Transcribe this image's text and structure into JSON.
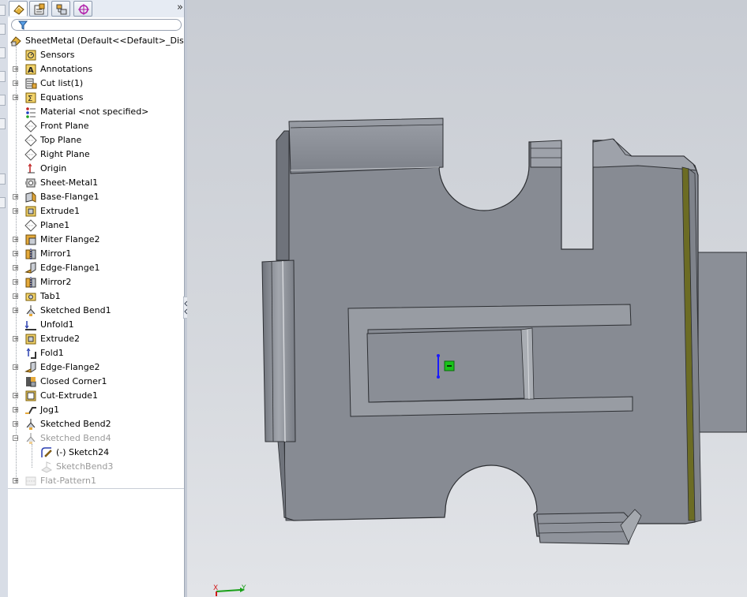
{
  "feature_tree": {
    "root": "SheetMetal  (Default<<Default>_Display",
    "items": [
      {
        "label": "Sensors",
        "expandable": false,
        "icon": "sensors-icon"
      },
      {
        "label": "Annotations",
        "expandable": true,
        "icon": "annotations-icon"
      },
      {
        "label": "Cut list(1)",
        "expandable": true,
        "icon": "cut-list-icon"
      },
      {
        "label": "Equations",
        "expandable": true,
        "icon": "equations-icon"
      },
      {
        "label": "Material <not specified>",
        "expandable": false,
        "icon": "material-icon"
      },
      {
        "label": "Front Plane",
        "expandable": false,
        "icon": "plane-icon"
      },
      {
        "label": "Top Plane",
        "expandable": false,
        "icon": "plane-icon"
      },
      {
        "label": "Right Plane",
        "expandable": false,
        "icon": "plane-icon"
      },
      {
        "label": "Origin",
        "expandable": false,
        "icon": "origin-icon"
      },
      {
        "label": "Sheet-Metal1",
        "expandable": false,
        "icon": "sheet-metal-icon"
      },
      {
        "label": "Base-Flange1",
        "expandable": true,
        "icon": "base-flange-icon"
      },
      {
        "label": "Extrude1",
        "expandable": true,
        "icon": "extrude-icon"
      },
      {
        "label": "Plane1",
        "expandable": false,
        "icon": "plane-icon"
      },
      {
        "label": "Miter Flange2",
        "expandable": true,
        "icon": "miter-flange-icon"
      },
      {
        "label": "Mirror1",
        "expandable": true,
        "icon": "mirror-icon"
      },
      {
        "label": "Edge-Flange1",
        "expandable": true,
        "icon": "edge-flange-icon"
      },
      {
        "label": "Mirror2",
        "expandable": true,
        "icon": "mirror-icon"
      },
      {
        "label": "Tab1",
        "expandable": true,
        "icon": "tab-icon"
      },
      {
        "label": "Sketched Bend1",
        "expandable": true,
        "icon": "sketched-bend-icon"
      },
      {
        "label": "Unfold1",
        "expandable": false,
        "icon": "unfold-icon"
      },
      {
        "label": "Extrude2",
        "expandable": true,
        "icon": "extrude-icon"
      },
      {
        "label": "Fold1",
        "expandable": false,
        "icon": "fold-icon"
      },
      {
        "label": "Edge-Flange2",
        "expandable": true,
        "icon": "edge-flange-icon"
      },
      {
        "label": "Closed Corner1",
        "expandable": false,
        "icon": "closed-corner-icon"
      },
      {
        "label": "Cut-Extrude1",
        "expandable": true,
        "icon": "cut-extrude-icon"
      },
      {
        "label": "Jog1",
        "expandable": true,
        "icon": "jog-icon"
      },
      {
        "label": "Sketched Bend2",
        "expandable": true,
        "icon": "sketched-bend-icon"
      },
      {
        "label": "Sketched Bend4",
        "expandable": true,
        "expanded": true,
        "dim": true,
        "icon": "sketched-bend-icon"
      },
      {
        "label": "(-) Sketch24",
        "expandable": false,
        "child": true,
        "icon": "sketch-icon"
      },
      {
        "label": "SketchBend3",
        "expandable": false,
        "child": true,
        "dim": true,
        "icon": "sketch-bend-icon"
      },
      {
        "label": "Flat-Pattern1",
        "expandable": true,
        "dim": true,
        "icon": "flat-pattern-icon"
      }
    ]
  },
  "panel_tabs": [
    "feature-manager-tab",
    "property-manager-tab",
    "configuration-manager-tab",
    "dimxpert-manager-tab"
  ],
  "triad": {
    "x_label": "X",
    "y_label": "Y"
  },
  "colors": {
    "model_face": "#878b93",
    "model_edge": "#2d2f33",
    "bend_highlight": "#6a6a1a",
    "sketch_line": "#1a1aff",
    "sketch_marker": "#19c419"
  }
}
